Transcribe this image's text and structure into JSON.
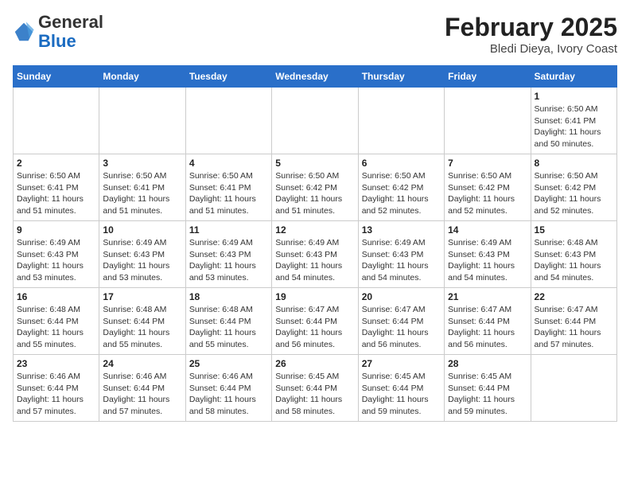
{
  "header": {
    "logo": {
      "general": "General",
      "blue": "Blue"
    },
    "month_year": "February 2025",
    "location": "Bledi Dieya, Ivory Coast"
  },
  "days_of_week": [
    "Sunday",
    "Monday",
    "Tuesday",
    "Wednesday",
    "Thursday",
    "Friday",
    "Saturday"
  ],
  "weeks": [
    {
      "days": [
        {
          "num": "",
          "empty": true
        },
        {
          "num": "",
          "empty": true
        },
        {
          "num": "",
          "empty": true
        },
        {
          "num": "",
          "empty": true
        },
        {
          "num": "",
          "empty": true
        },
        {
          "num": "",
          "empty": true
        },
        {
          "num": "1",
          "sunrise": "6:50 AM",
          "sunset": "6:41 PM",
          "daylight": "11 hours and 50 minutes."
        }
      ]
    },
    {
      "days": [
        {
          "num": "2",
          "sunrise": "6:50 AM",
          "sunset": "6:41 PM",
          "daylight": "11 hours and 51 minutes."
        },
        {
          "num": "3",
          "sunrise": "6:50 AM",
          "sunset": "6:41 PM",
          "daylight": "11 hours and 51 minutes."
        },
        {
          "num": "4",
          "sunrise": "6:50 AM",
          "sunset": "6:41 PM",
          "daylight": "11 hours and 51 minutes."
        },
        {
          "num": "5",
          "sunrise": "6:50 AM",
          "sunset": "6:42 PM",
          "daylight": "11 hours and 51 minutes."
        },
        {
          "num": "6",
          "sunrise": "6:50 AM",
          "sunset": "6:42 PM",
          "daylight": "11 hours and 52 minutes."
        },
        {
          "num": "7",
          "sunrise": "6:50 AM",
          "sunset": "6:42 PM",
          "daylight": "11 hours and 52 minutes."
        },
        {
          "num": "8",
          "sunrise": "6:50 AM",
          "sunset": "6:42 PM",
          "daylight": "11 hours and 52 minutes."
        }
      ]
    },
    {
      "days": [
        {
          "num": "9",
          "sunrise": "6:49 AM",
          "sunset": "6:43 PM",
          "daylight": "11 hours and 53 minutes."
        },
        {
          "num": "10",
          "sunrise": "6:49 AM",
          "sunset": "6:43 PM",
          "daylight": "11 hours and 53 minutes."
        },
        {
          "num": "11",
          "sunrise": "6:49 AM",
          "sunset": "6:43 PM",
          "daylight": "11 hours and 53 minutes."
        },
        {
          "num": "12",
          "sunrise": "6:49 AM",
          "sunset": "6:43 PM",
          "daylight": "11 hours and 54 minutes."
        },
        {
          "num": "13",
          "sunrise": "6:49 AM",
          "sunset": "6:43 PM",
          "daylight": "11 hours and 54 minutes."
        },
        {
          "num": "14",
          "sunrise": "6:49 AM",
          "sunset": "6:43 PM",
          "daylight": "11 hours and 54 minutes."
        },
        {
          "num": "15",
          "sunrise": "6:48 AM",
          "sunset": "6:43 PM",
          "daylight": "11 hours and 54 minutes."
        }
      ]
    },
    {
      "days": [
        {
          "num": "16",
          "sunrise": "6:48 AM",
          "sunset": "6:44 PM",
          "daylight": "11 hours and 55 minutes."
        },
        {
          "num": "17",
          "sunrise": "6:48 AM",
          "sunset": "6:44 PM",
          "daylight": "11 hours and 55 minutes."
        },
        {
          "num": "18",
          "sunrise": "6:48 AM",
          "sunset": "6:44 PM",
          "daylight": "11 hours and 55 minutes."
        },
        {
          "num": "19",
          "sunrise": "6:47 AM",
          "sunset": "6:44 PM",
          "daylight": "11 hours and 56 minutes."
        },
        {
          "num": "20",
          "sunrise": "6:47 AM",
          "sunset": "6:44 PM",
          "daylight": "11 hours and 56 minutes."
        },
        {
          "num": "21",
          "sunrise": "6:47 AM",
          "sunset": "6:44 PM",
          "daylight": "11 hours and 56 minutes."
        },
        {
          "num": "22",
          "sunrise": "6:47 AM",
          "sunset": "6:44 PM",
          "daylight": "11 hours and 57 minutes."
        }
      ]
    },
    {
      "days": [
        {
          "num": "23",
          "sunrise": "6:46 AM",
          "sunset": "6:44 PM",
          "daylight": "11 hours and 57 minutes."
        },
        {
          "num": "24",
          "sunrise": "6:46 AM",
          "sunset": "6:44 PM",
          "daylight": "11 hours and 57 minutes."
        },
        {
          "num": "25",
          "sunrise": "6:46 AM",
          "sunset": "6:44 PM",
          "daylight": "11 hours and 58 minutes."
        },
        {
          "num": "26",
          "sunrise": "6:45 AM",
          "sunset": "6:44 PM",
          "daylight": "11 hours and 58 minutes."
        },
        {
          "num": "27",
          "sunrise": "6:45 AM",
          "sunset": "6:44 PM",
          "daylight": "11 hours and 59 minutes."
        },
        {
          "num": "28",
          "sunrise": "6:45 AM",
          "sunset": "6:44 PM",
          "daylight": "11 hours and 59 minutes."
        },
        {
          "num": "",
          "empty": true
        }
      ]
    }
  ]
}
